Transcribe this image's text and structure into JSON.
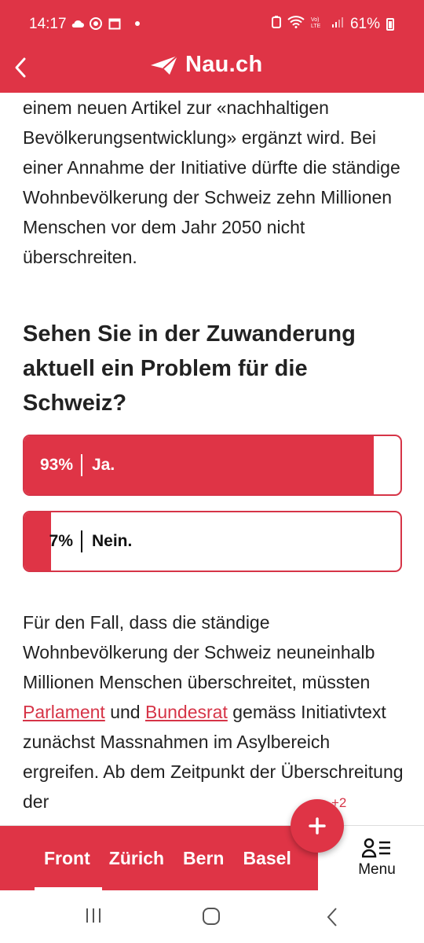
{
  "status_bar": {
    "time": "14:17",
    "battery": "61%",
    "left_icons": [
      "cloud-icon",
      "chrome-icon",
      "calendar-icon"
    ],
    "right_icons": [
      "battery-saver-icon",
      "wifi-icon",
      "volte-icon",
      "signal-icon",
      "battery-icon"
    ]
  },
  "header": {
    "logo_text": "Nau.ch",
    "back_icon": "chevron-left-icon"
  },
  "article": {
    "paragraph1": "einem neuen Artikel zur «nachhaltigen Bevölkerungsentwicklung» ergänzt wird. Bei einer Annahme der Initiative dürfte die ständige Wohnbevölkerung der Schweiz zehn Millionen Menschen vor dem Jahr 2050 nicht überschreiten.",
    "poll": {
      "question": "Sehen Sie in der Zuwanderung aktuell ein Problem für die Schweiz?",
      "options": [
        {
          "percent_label": "93%",
          "label": "Ja.",
          "share": 0.93
        },
        {
          "percent_label": "7%",
          "label": "Nein.",
          "share": 0.07
        }
      ]
    },
    "paragraph2": {
      "part1": "Für den Fall, dass die ständige Wohnbevölkerung der Schweiz neuneinhalb Millionen Menschen überschreitet, müssten ",
      "link1": "Parlament",
      "part2": " und ",
      "link2": "Bundesrat",
      "part3": " gemäss Initiativtext zunächst Massnahmen im Asylbereich ergreifen. Ab dem Zeitpunkt der Überschreitung der"
    }
  },
  "bottom_nav": {
    "items": [
      "Front",
      "Zürich",
      "Bern",
      "Basel"
    ],
    "active": "Front",
    "menu_label": "Menu",
    "fab_badge": "+2"
  },
  "colors": {
    "brand_red": "#df3446",
    "text": "#222222"
  }
}
